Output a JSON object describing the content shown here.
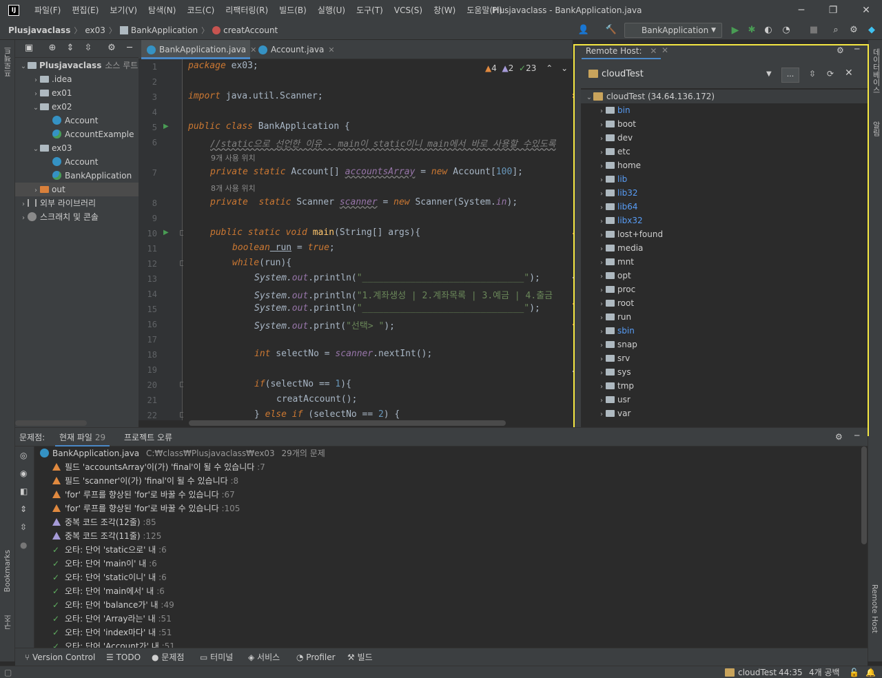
{
  "window": {
    "title": "Plusjavaclass - BankApplication.java",
    "logo_text": "IJ",
    "menu": [
      "파일(F)",
      "편집(E)",
      "보기(V)",
      "탐색(N)",
      "코드(C)",
      "리팩터링(R)",
      "빌드(B)",
      "실행(U)",
      "도구(T)",
      "VCS(S)",
      "창(W)",
      "도움말(H)"
    ]
  },
  "breadcrumb": [
    "Plusjavaclass",
    "ex03",
    "BankApplication",
    "creatAccount"
  ],
  "toolbar": {
    "run_config": "BankApplication"
  },
  "left_stripe": {
    "project_label": "프로젝트",
    "bookmarks_label": "Bookmarks",
    "structure_label": "구조"
  },
  "right_stripe": {
    "database_label": "데이터베이스",
    "notifications_label": "알림",
    "remote_host_label": "Remote Host"
  },
  "project_tree": [
    {
      "label": "Plusjavaclass",
      "suffix": "소스 루트,",
      "type": "module",
      "level": 0,
      "expanded": true
    },
    {
      "label": ".idea",
      "type": "folder",
      "level": 1,
      "expanded": false
    },
    {
      "label": "ex01",
      "type": "folder",
      "level": 1,
      "expanded": false
    },
    {
      "label": "ex02",
      "type": "folder",
      "level": 1,
      "expanded": true
    },
    {
      "label": "Account",
      "type": "class",
      "level": 2
    },
    {
      "label": "AccountExample",
      "type": "class-main",
      "level": 2
    },
    {
      "label": "ex03",
      "type": "folder",
      "level": 1,
      "expanded": true
    },
    {
      "label": "Account",
      "type": "class",
      "level": 2
    },
    {
      "label": "BankApplication",
      "type": "class-main",
      "level": 2
    },
    {
      "label": "out",
      "type": "folder-orange",
      "level": 1,
      "expanded": false,
      "selected": true
    },
    {
      "label": "외부 라이브러리",
      "type": "library",
      "level": 0,
      "expanded": false
    },
    {
      "label": "스크래치 및 콘솔",
      "type": "scratch",
      "level": 0,
      "expanded": false
    }
  ],
  "editor": {
    "tabs": [
      {
        "label": "BankApplication.java",
        "active": true
      },
      {
        "label": "Account.java",
        "active": false
      }
    ],
    "inspection": {
      "warnings": "4",
      "weak": "2",
      "typos": "23"
    },
    "line_numbers": [
      "1",
      "2",
      "3",
      "4",
      "5",
      "6",
      "",
      "7",
      "",
      "8",
      "9",
      "10",
      "11",
      "12",
      "13",
      "14",
      "15",
      "16",
      "17",
      "18",
      "19",
      "20",
      "21",
      "22"
    ],
    "hint_usage_1": "9개 사용 위치",
    "hint_usage_2": "8개 사용 위치",
    "code": {
      "l1_kw": "package",
      "l1_rest": " ex03;",
      "l3_kw": "import",
      "l3_rest": " java.util.Scanner;",
      "l5_kw": "public class",
      "l5_rest": " BankApplication {",
      "l6_comment": "//static으로 선언한 이유 - main이 static이니 main에서 바로 사용할 수있도록",
      "l7_kw": "private static",
      "l7_type": " Account[] ",
      "l7_field": "accountsArray",
      "l7_eq": " = ",
      "l7_new": "new",
      "l7_rest": " Account[",
      "l7_num": "100",
      "l7_end": "];",
      "l8_kw": "private  static",
      "l8_type": " Scanner ",
      "l8_field": "scanner",
      "l8_eq": " = ",
      "l8_new": "new",
      "l8_rest": " Scanner(System.",
      "l8_in": "in",
      "l8_end": ");",
      "l10_kw": "public static void",
      "l10_fn": " main",
      "l10_rest": "(String[] args){",
      "l11_kw": "boolean",
      "l11_var": " run",
      "l11_eq": " = ",
      "l11_val": "true",
      "l11_end": ";",
      "l12_kw": "while",
      "l12_rest": "(run){",
      "l13_sys": "System.",
      "l13_out": "out",
      "l13_call": ".println(",
      "l13_str": "\"______________________________\"",
      "l13_end": ");",
      "l14_str": "\"1.계좌생성 | 2.계좌목록 | 3.예금 | 4.출금",
      "l15_str": "\"______________________________\"",
      "l16_call": ".print(",
      "l16_str": "\"선택> \"",
      "l18_kw": "int",
      "l18_var": " selectNo",
      "l18_eq": " = ",
      "l18_obj": "scanner",
      "l18_call": ".nextInt();",
      "l20_kw": "if",
      "l20_rest": "(selectNo ",
      "l20_op": "==",
      "l20_num": " 1",
      "l20_end": "){",
      "l21_call": "creatAccount();",
      "l22_close": "} ",
      "l22_kw": "else if",
      "l22_rest": " (selectNo ",
      "l22_op": "==",
      "l22_num": " 2",
      "l22_end": ") {"
    }
  },
  "remote_host": {
    "tab_label": "Remote Host:",
    "server_name": "cloudTest",
    "more_button": "...",
    "root_label": "cloudTest (34.64.136.172)",
    "dirs": [
      {
        "name": "bin",
        "link": true
      },
      {
        "name": "boot",
        "link": false
      },
      {
        "name": "dev",
        "link": false
      },
      {
        "name": "etc",
        "link": false
      },
      {
        "name": "home",
        "link": false
      },
      {
        "name": "lib",
        "link": true
      },
      {
        "name": "lib32",
        "link": true
      },
      {
        "name": "lib64",
        "link": true
      },
      {
        "name": "libx32",
        "link": true
      },
      {
        "name": "lost+found",
        "link": false
      },
      {
        "name": "media",
        "link": false
      },
      {
        "name": "mnt",
        "link": false
      },
      {
        "name": "opt",
        "link": false
      },
      {
        "name": "proc",
        "link": false
      },
      {
        "name": "root",
        "link": false
      },
      {
        "name": "run",
        "link": false
      },
      {
        "name": "sbin",
        "link": true
      },
      {
        "name": "snap",
        "link": false
      },
      {
        "name": "srv",
        "link": false
      },
      {
        "name": "sys",
        "link": false
      },
      {
        "name": "tmp",
        "link": false
      },
      {
        "name": "usr",
        "link": false
      },
      {
        "name": "var",
        "link": false
      }
    ]
  },
  "problems": {
    "title": "문제점:",
    "tabs": {
      "current_file": "현재 파일",
      "current_count": "29",
      "project_errors": "프로젝트 오류"
    },
    "file": "BankApplication.java",
    "path": "C:₩class₩Plusjavaclass₩ex03",
    "count": "29개의 문제",
    "items": [
      {
        "kind": "warn",
        "text": "필드 'accountsArray'이(가) 'final'이 될 수 있습니다",
        "line": ":7"
      },
      {
        "kind": "warn",
        "text": "필드 'scanner'이(가) 'final'이 될 수 있습니다",
        "line": ":8"
      },
      {
        "kind": "warn",
        "text": "'for' 루프를 향상된 'for'로 바꿀 수 있습니다",
        "line": ":67"
      },
      {
        "kind": "warn",
        "text": "'for' 루프를 향상된 'for'로 바꿀 수 있습니다",
        "line": ":105"
      },
      {
        "kind": "weak",
        "text": "중복 코드 조각(12줄)",
        "line": ":85"
      },
      {
        "kind": "weak",
        "text": "중복 코드 조각(11줄)",
        "line": ":125"
      },
      {
        "kind": "typo",
        "text": "오타: 단어 'static으로' 내",
        "line": ":6"
      },
      {
        "kind": "typo",
        "text": "오타: 단어 'main이' 내",
        "line": ":6"
      },
      {
        "kind": "typo",
        "text": "오타: 단어 'static이니' 내",
        "line": ":6"
      },
      {
        "kind": "typo",
        "text": "오타: 단어 'main에서' 내",
        "line": ":6"
      },
      {
        "kind": "typo",
        "text": "오타: 단어 'balance가' 내",
        "line": ":49"
      },
      {
        "kind": "typo",
        "text": "오타: 단어 'Array라는' 내",
        "line": ":51"
      },
      {
        "kind": "typo",
        "text": "오타: 단어 'index마다' 내",
        "line": ":51"
      },
      {
        "kind": "typo",
        "text": "오타: 단어 'Account가' 내",
        "line": ":51"
      }
    ]
  },
  "bottom_tools": [
    "Version Control",
    "TODO",
    "문제점",
    "터미널",
    "서비스",
    "Profiler",
    "빌드"
  ],
  "status": {
    "server": "cloudTest",
    "position": "44:35",
    "indent": "4개 공백"
  },
  "colors": {
    "accent": "#4a88c7",
    "highlight_border": "#f6e843",
    "warning": "#e0893f",
    "weak_warning": "#a69bd8",
    "typo": "#5faf5f"
  }
}
